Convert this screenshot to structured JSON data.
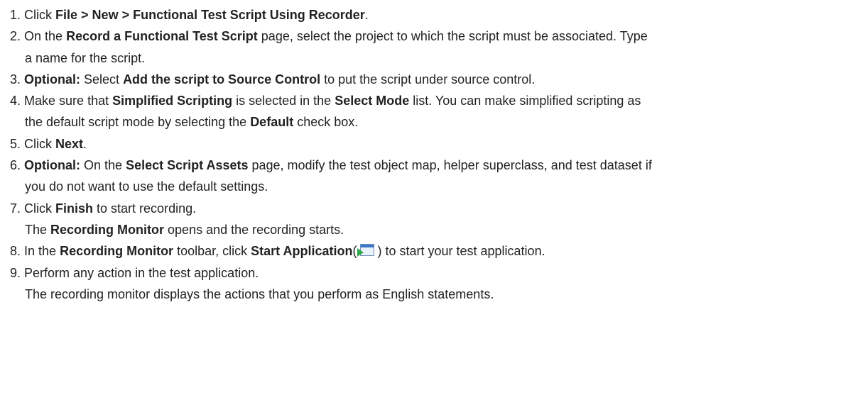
{
  "steps": [
    {
      "num": "1.",
      "t1": "Click ",
      "b1": "File > New  > Functional Test Script Using Recorder",
      "t2": "."
    },
    {
      "num": "2.",
      "t1": "On the ",
      "b1": "Record a Functional Test Script",
      "t2": "  page, select the project to which the script must be associated. Type",
      "cont": "a name for the script."
    },
    {
      "num": "3.",
      "b1": "Optional:",
      "t1": " Select ",
      "b2": "Add the script to Source Control",
      "t2": " to put the script under source control."
    },
    {
      "num": "4.",
      "t1": "Make sure that ",
      "b1": "Simplified Scripting",
      "t2": " is selected in the ",
      "b2": "Select Mode",
      "t3": " list. You can make simplified scripting as",
      "c1": "the default script mode by selecting the ",
      "cb": "Default",
      "c2": " check box."
    },
    {
      "num": "5.",
      "t1": "Click ",
      "b1": "Next",
      "t2": "."
    },
    {
      "num": "6.",
      "b1": "Optional:",
      "t1": " On the ",
      "b2": "Select Script Assets",
      "t2": " page, modify the test object map, helper superclass, and test dataset if",
      "cont": "you do not want to use the default settings."
    },
    {
      "num": "7.",
      "t1": "Click ",
      "b1": "Finish",
      "t2": " to start recording.",
      "c1": "The ",
      "cb": "Recording Monitor",
      "c2": " opens and the recording starts."
    },
    {
      "num": "8.",
      "t1": "In the ",
      "b1": "Recording Monitor",
      "t2": " toolbar, click ",
      "b2": "Start Application",
      "t3": "(",
      "t4": ") to start your test application.",
      "icon": "start-application-icon"
    },
    {
      "num": "9.",
      "t1": "Perform any action in the test application.",
      "cont": "The recording monitor displays the actions that you perform as English statements."
    }
  ]
}
